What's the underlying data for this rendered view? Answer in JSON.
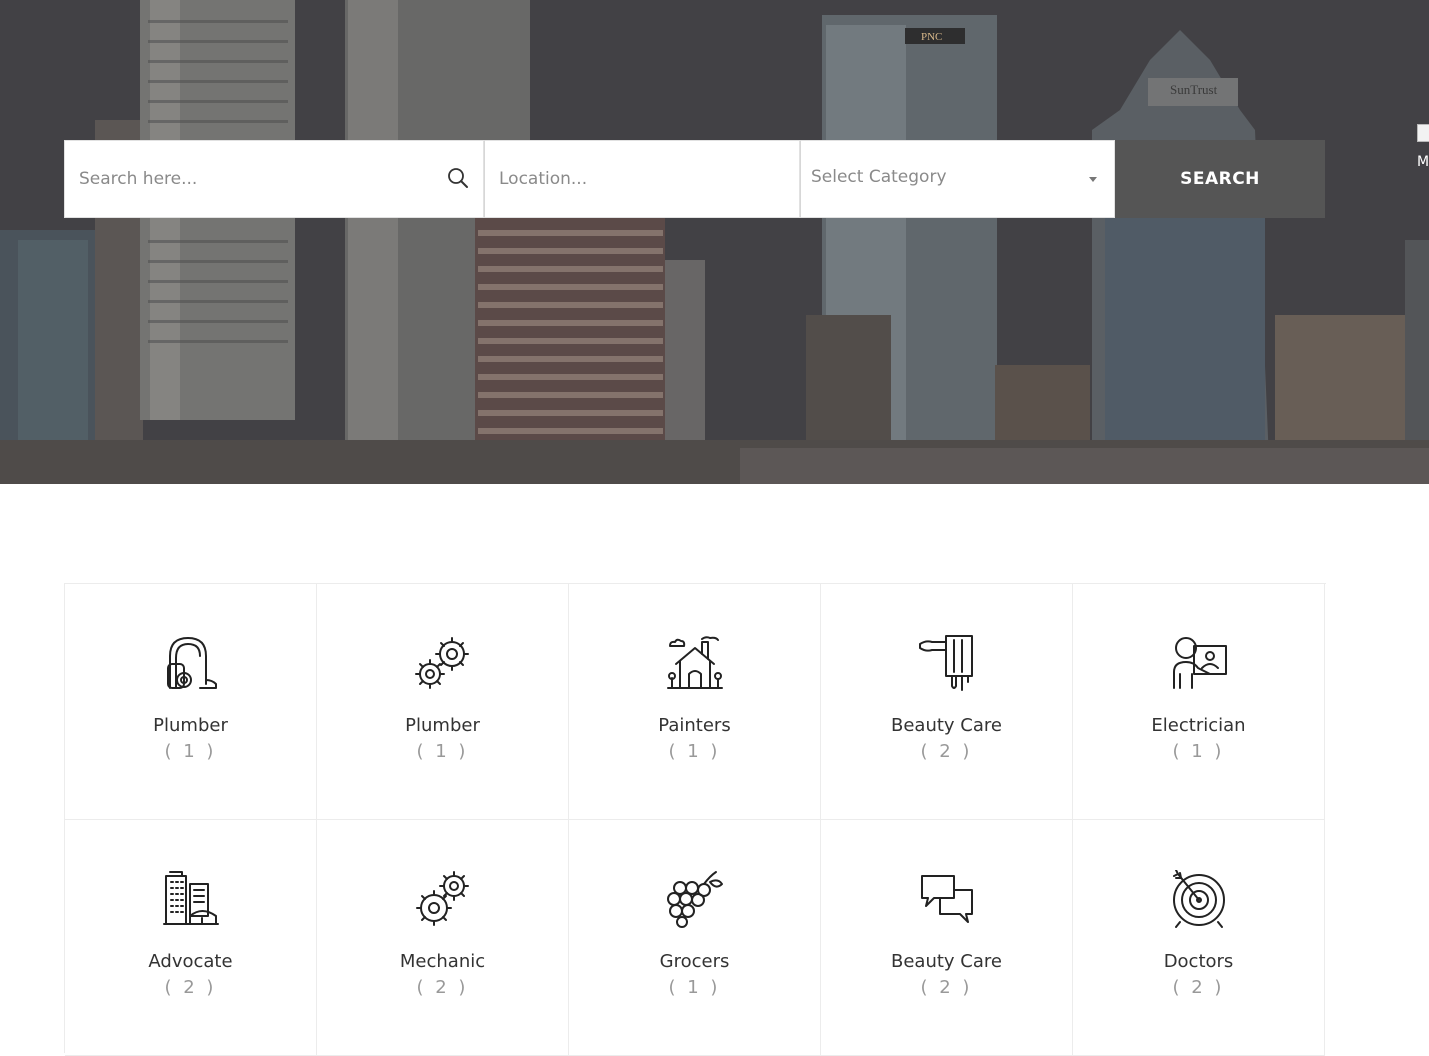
{
  "hero": {
    "billboard_left": "PNC",
    "billboard_right": "SunTrust",
    "broken_image_text": "M"
  },
  "search": {
    "keyword_placeholder": "Search here...",
    "location_placeholder": "Location...",
    "category_selected": "Select Category",
    "button_label": "SEARCH"
  },
  "categories": [
    {
      "name": "Plumber",
      "count": "( 1 )",
      "icon": "vacuum-cleaner-icon"
    },
    {
      "name": "Plumber",
      "count": "( 1 )",
      "icon": "gears-icon"
    },
    {
      "name": "Painters",
      "count": "( 1 )",
      "icon": "house-icon"
    },
    {
      "name": "Beauty Care",
      "count": "( 2 )",
      "icon": "paint-brush-icon"
    },
    {
      "name": "Electrician",
      "count": "( 1 )",
      "icon": "teacher-screen-icon"
    },
    {
      "name": "Advocate",
      "count": "( 2 )",
      "icon": "buildings-icon"
    },
    {
      "name": "Mechanic",
      "count": "( 2 )",
      "icon": "cogs-icon"
    },
    {
      "name": "Grocers",
      "count": "( 1 )",
      "icon": "grapes-icon"
    },
    {
      "name": "Beauty Care",
      "count": "( 2 )",
      "icon": "chat-bubbles-icon"
    },
    {
      "name": "Doctors",
      "count": "( 2 )",
      "icon": "target-icon"
    }
  ],
  "colors": {
    "search_button": "#555555",
    "hero_overlay": "#4a494c",
    "text_dark": "#333333",
    "text_muted": "#999999"
  }
}
